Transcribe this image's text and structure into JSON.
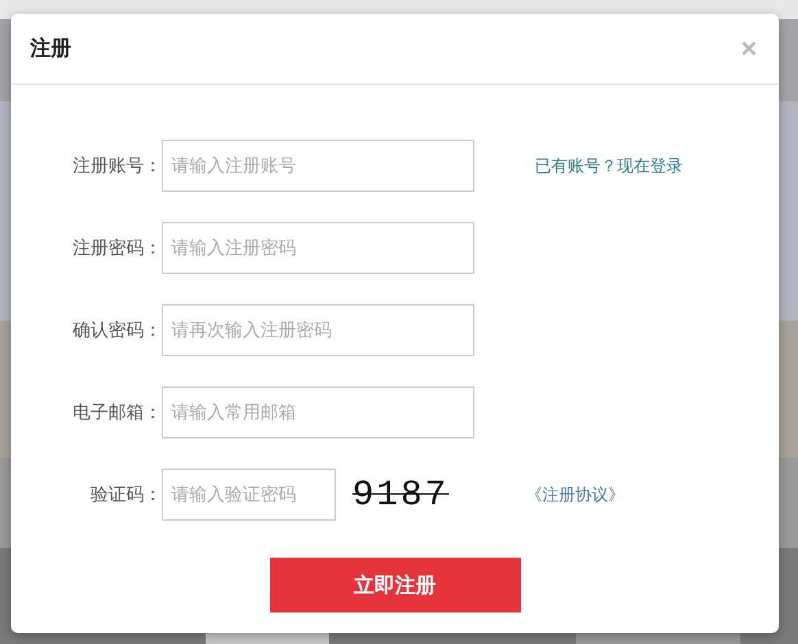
{
  "dialog": {
    "title": "注册",
    "close": "×"
  },
  "fields": [
    {
      "label": "注册账号：",
      "placeholder": "请输入注册账号",
      "kind": "text"
    },
    {
      "label": "注册密码：",
      "placeholder": "请输入注册密码",
      "kind": "password"
    },
    {
      "label": "确认密码：",
      "placeholder": "请再次输入注册密码",
      "kind": "password"
    },
    {
      "label": "电子邮箱：",
      "placeholder": "请输入常用邮箱",
      "kind": "email"
    },
    {
      "label": "验证码：",
      "placeholder": "请输入验证密码",
      "kind": "captcha"
    }
  ],
  "login_link": "已有账号？现在登录",
  "captcha": "9187",
  "agreement_link": "《注册协议》",
  "submit": "立即注册"
}
